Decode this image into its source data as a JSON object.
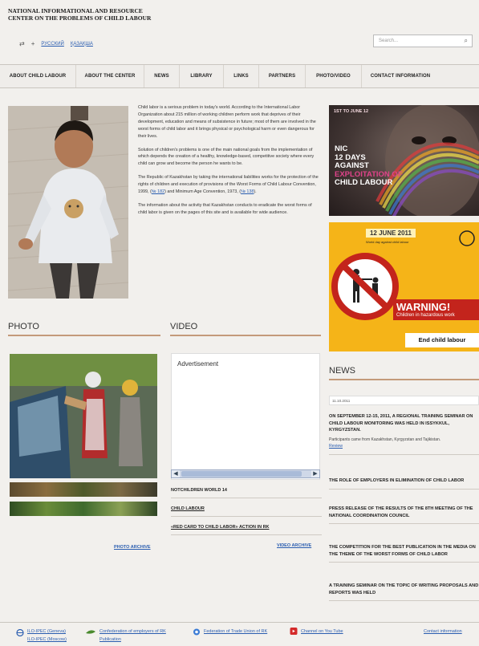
{
  "header": {
    "title_line1": "NATIONAL INFORMATIONAL AND RESOURCE",
    "title_line2": "CENTER ON THE PROBLEMS OF CHILD LABOUR",
    "lang_links": [
      "РУССКИЙ",
      "ҚАЗАҚША"
    ],
    "search_placeholder": "Search..."
  },
  "nav": {
    "items": [
      "ABOUT CHILD LABOUR",
      "ABOUT THE CENTER",
      "NEWS",
      "LIBRARY",
      "LINKS",
      "PARTNERS",
      "PHOTO/VIDEO",
      "CONTACT INFORMATION"
    ]
  },
  "intro": {
    "p1": "Child labor is a serious problem in today's world. According to the International Labor Organization about 215 million of working children perform work that deprives of their development, education and means of subsistence in future; most of them are involved in the worst forms of child labor and it brings physical or psychological harm or even dangerous for their lives.",
    "p2": "Solution of children's problems is one of the main national goals from the implementation of which depends the creation of a healthy, knowledge-based, competitive society where every child can grow and become the person he wants to be.",
    "p3_a": "The Republic of Kazakhstan by taking the international liabilities works for the protection of the rights of children and execution of provisions of the Worst Forms of Child Labour Convention, 1999, (",
    "p3_link1": "№ 182",
    "p3_b": ") and Minimum Age Convention, 1973, (",
    "p3_link2": "№ 138",
    "p3_c": ").",
    "p4": "The information about the activity that Kazakhstan conducts to eradicate the worst forms of child labor is given on the pages of this site and is available for wide audience."
  },
  "banner1": {
    "date": "1ST TO JUNE 12",
    "l1": "NIC",
    "l2": "12 DAYS",
    "l3": "AGAINST",
    "l4": "EXPLOITATION OF",
    "l5": "CHILD LABOUR"
  },
  "banner2": {
    "date": "12 JUNE 2011",
    "sub": "World day against child labour",
    "warning": "WARNING!",
    "warning_sub": "Children in hazardous work",
    "end": "End child labour"
  },
  "photo": {
    "title": "PHOTO",
    "archive": "PHOTO ARCHIVE"
  },
  "video": {
    "title": "VIDEO",
    "advertisement": "Advertisement",
    "items": [
      "NOTCHILDREN WORLD 14",
      "CHILD LABOUR",
      "«RED CARD TO CHILD LABOR» ACTION IN RK"
    ],
    "archive": "VIDEO ARCHIVE"
  },
  "news": {
    "title": "NEWS",
    "date": "11.10.2011",
    "items": [
      "ON SEPTEMBER 12-15, 2011, A REGIONAL TRAINING SEMINAR ON CHILD LABOUR MONITORING WAS HELD IN ISSYKKUL, KYRGYZSTAN.",
      "THE ROLE OF EMPLOYERS IN ELIMINATION OF CHILD LABOR",
      "PRESS RELEASE OF THE RESULTS OF THE 8TH MEETING OF THE NATIONAL COORDINATION COUNCIL",
      "THE COMPETITION FOR THE BEST PUBLICATION IN THE MEDIA ON THE THEME OF THE WORST FORMS OF CHILD LABOR",
      "A TRAINING SEMINAR ON THE TOPIC OF WRITING PROPOSALS AND REPORTS WAS HELD"
    ],
    "first_body": "Participants came from Kazakhstan, Kyrgyzstan and Tajikistan.",
    "first_more": "Review"
  },
  "footer": {
    "ilo_geneva": "ILO-IPEC (Geneva)",
    "ilo_moscow": "ILO-IPEC (Moscow)",
    "confed_1": "Confederation of employers of RK",
    "confed_2": "Publication",
    "federation": "Federation of Trade Union of RK",
    "youtube": "Channel on You Tube",
    "contact": "Contact information"
  }
}
